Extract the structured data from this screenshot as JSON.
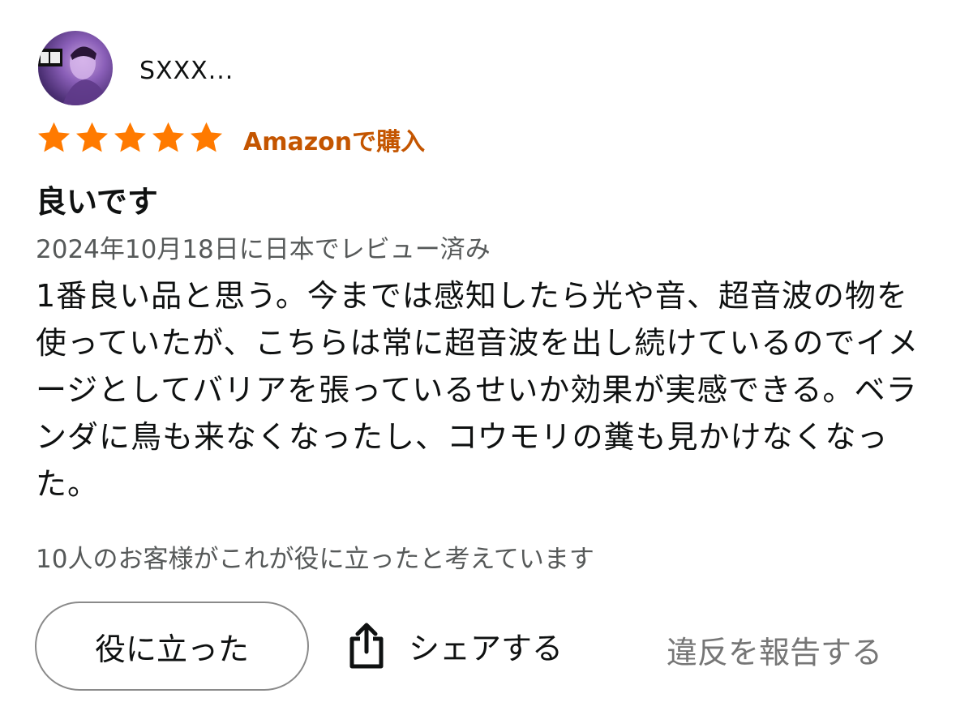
{
  "review": {
    "username": "SXXX...",
    "rating": 5,
    "max_rating": 5,
    "badge": "Amazonで購入",
    "title": "良いです",
    "date_line": "2024年10月18日に日本でレビュー済み",
    "body": "1番良い品と思う。今までは感知したら光や音、超音波の物を使っていたが、こちらは常に超音波を出し続けているのでイメージとしてバリアを張っているせいか効果が実感できる。ベランダに鳥も来なくなったし、コウモリの糞も見かけなくなった。",
    "helpful_count_text": "10人のお客様がこれが役に立ったと考えています"
  },
  "actions": {
    "helpful_label": "役に立った",
    "share_label": "シェアする",
    "report_label": "違反を報告する"
  },
  "colors": {
    "star": "#ff7a00",
    "badge": "#c45500",
    "muted": "#565959"
  },
  "icons": {
    "avatar": "user-avatar",
    "star": "star-icon",
    "share": "share-icon"
  }
}
